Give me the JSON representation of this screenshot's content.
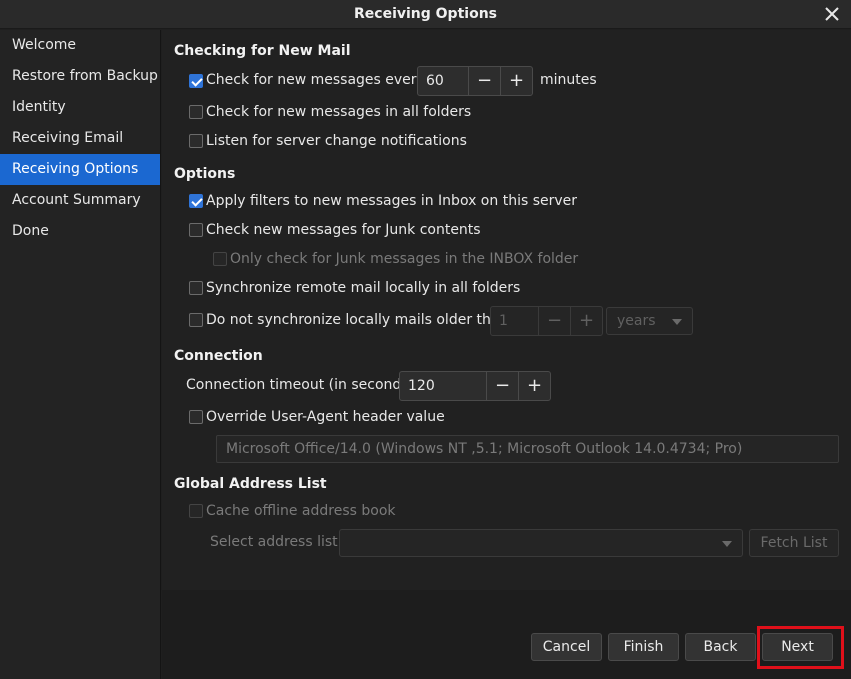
{
  "window": {
    "title": "Receiving Options"
  },
  "sidebar": {
    "items": [
      {
        "label": "Welcome",
        "active": false
      },
      {
        "label": "Restore from Backup",
        "active": false
      },
      {
        "label": "Identity",
        "active": false
      },
      {
        "label": "Receiving Email",
        "active": false
      },
      {
        "label": "Receiving Options",
        "active": true
      },
      {
        "label": "Account Summary",
        "active": false
      },
      {
        "label": "Done",
        "active": false
      }
    ]
  },
  "checking": {
    "heading": "Checking for New Mail",
    "check_every_label": "Check for new messages every",
    "check_every_checked": true,
    "interval_value": "60",
    "interval_unit": "minutes",
    "all_folders_label": "Check for new messages in all folders",
    "all_folders_checked": false,
    "listen_label": "Listen for server change notifications",
    "listen_checked": false
  },
  "options": {
    "heading": "Options",
    "apply_filters_label": "Apply filters to new messages in Inbox on this server",
    "apply_filters_checked": true,
    "junk_label": "Check new messages for Junk contents",
    "junk_checked": false,
    "junk_inbox_label": "Only check for Junk messages in the INBOX folder",
    "junk_inbox_checked": false,
    "sync_label": "Synchronize remote mail locally in all folders",
    "sync_checked": false,
    "older_label": "Do not synchronize locally mails older than",
    "older_checked": false,
    "older_value": "1",
    "older_unit": "years"
  },
  "connection": {
    "heading": "Connection",
    "timeout_label": "Connection timeout (in seconds)",
    "timeout_value": "120",
    "override_label": "Override User-Agent header value",
    "override_checked": false,
    "user_agent_value": "Microsoft Office/14.0 (Windows NT ,5.1; Microsoft Outlook 14.0.4734; Pro)"
  },
  "gal": {
    "heading": "Global Address List",
    "cache_label": "Cache offline address book",
    "cache_checked": false,
    "select_label": "Select address list:",
    "select_value": "",
    "fetch_label": "Fetch List"
  },
  "footer": {
    "cancel": "Cancel",
    "finish": "Finish",
    "back": "Back",
    "next": "Next"
  },
  "symbols": {
    "minus": "−",
    "plus": "+"
  },
  "colors": {
    "accent": "#1b68d1",
    "checkbox": "#2f74d8",
    "highlight": "#e0101a"
  }
}
